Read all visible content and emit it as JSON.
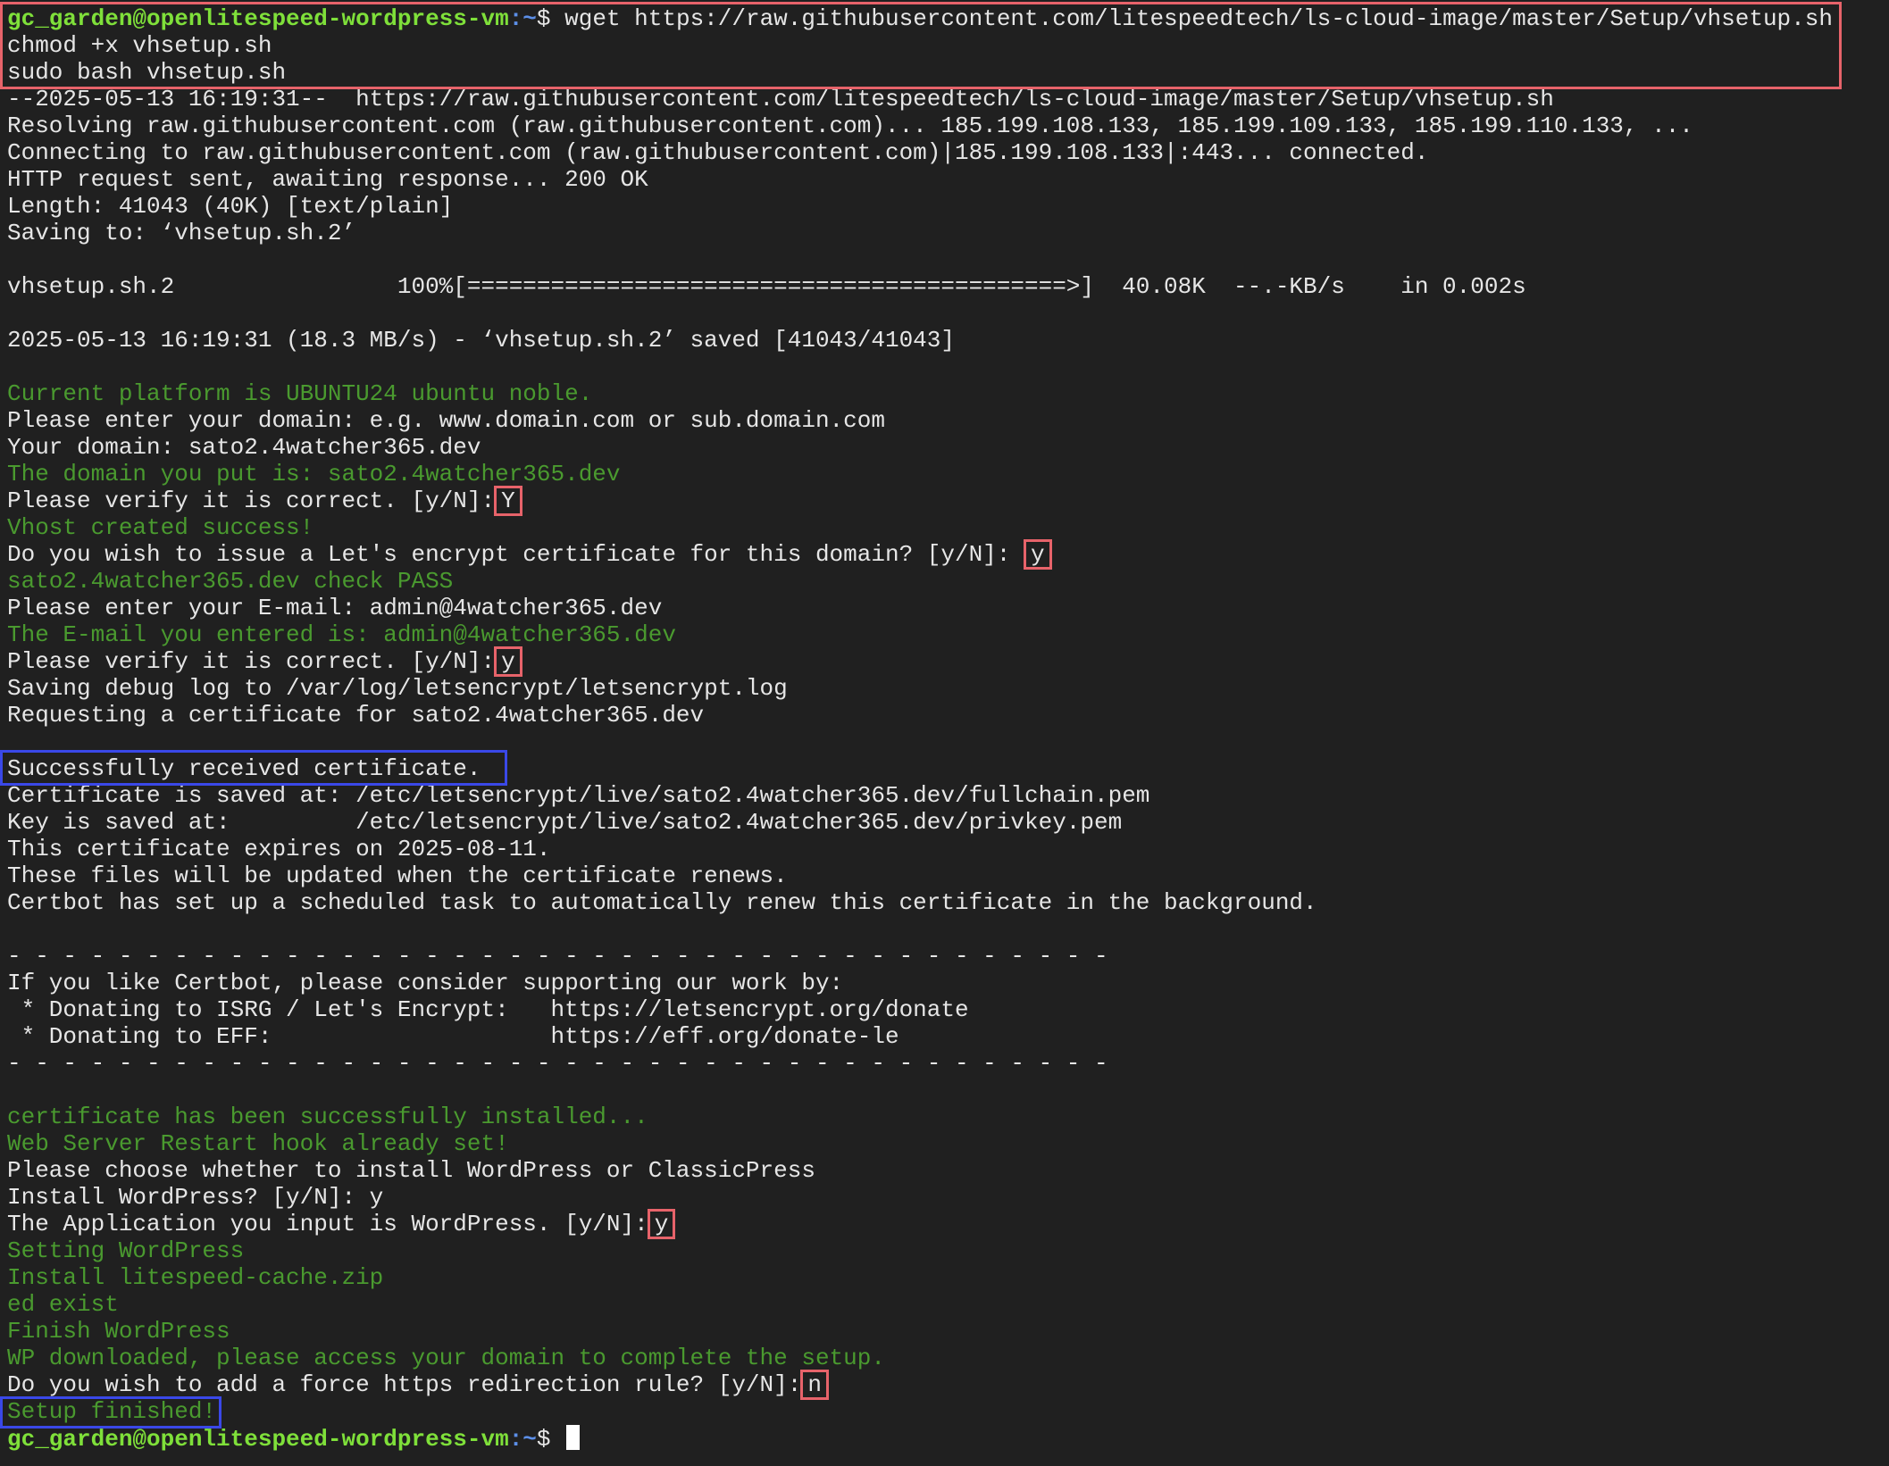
{
  "colors": {
    "background": "#202020",
    "text": "#e6e6e6",
    "info_green": "#4a9a2f",
    "prompt_green": "#7fe03a",
    "prompt_blue": "#5c8fe8",
    "highlight_red": "#e7636a",
    "highlight_blue": "#3a48e8"
  },
  "prompt": {
    "user_host": "gc_garden@openlitespeed-wordpress-vm",
    "path": ":~",
    "symbol": "$ "
  },
  "commands": {
    "wget": "wget https://raw.githubusercontent.com/litespeedtech/ls-cloud-image/master/Setup/vhsetup.sh",
    "chmod": "chmod +x vhsetup.sh",
    "sudo": "sudo bash vhsetup.sh"
  },
  "wget_output": {
    "start": "--2025-05-13 16:19:31--  https://raw.githubusercontent.com/litespeedtech/ls-cloud-image/master/Setup/vhsetup.sh",
    "resolving": "Resolving raw.githubusercontent.com (raw.githubusercontent.com)... 185.199.108.133, 185.199.109.133, 185.199.110.133, ...",
    "connecting": "Connecting to raw.githubusercontent.com (raw.githubusercontent.com)|185.199.108.133|:443... connected.",
    "http": "HTTP request sent, awaiting response... 200 OK",
    "length": "Length: 41043 (40K) [text/plain]",
    "saving": "Saving to: ‘vhsetup.sh.2’",
    "progress": "vhsetup.sh.2                100%[===========================================>]  40.08K  --.-KB/s    in 0.002s",
    "saved": "2025-05-13 16:19:31 (18.3 MB/s) - ‘vhsetup.sh.2’ saved [41043/41043]"
  },
  "setup": {
    "platform": "Current platform is UBUNTU24 ubuntu noble.",
    "enter_domain": "Please enter your domain: e.g. www.domain.com or sub.domain.com",
    "your_domain": "Your domain: sato2.4watcher365.dev",
    "domain_put": "The domain you put is: sato2.4watcher365.dev",
    "verify1_q": "Please verify it is correct. [y/N]:",
    "verify1_a": "Y",
    "vhost_created": "Vhost created success!",
    "le_q": "Do you wish to issue a Let's encrypt certificate for this domain? [y/N]:",
    "le_a": "y",
    "check_pass": "sato2.4watcher365.dev check PASS",
    "enter_email": "Please enter your E-mail: admin@4watcher365.dev",
    "email_entered": "The E-mail you entered is: admin@4watcher365.dev",
    "verify2_q": "Please verify it is correct. [y/N]:",
    "verify2_a": "y",
    "debug_log": "Saving debug log to /var/log/letsencrypt/letsencrypt.log",
    "requesting": "Requesting a certificate for sato2.4watcher365.dev"
  },
  "certbot": {
    "success": "Successfully received certificate.",
    "cert_saved": "Certificate is saved at: /etc/letsencrypt/live/sato2.4watcher365.dev/fullchain.pem",
    "key_saved": "Key is saved at:         /etc/letsencrypt/live/sato2.4watcher365.dev/privkey.pem",
    "expires": "This certificate expires on 2025-08-11.",
    "updated": "These files will be updated when the certificate renews.",
    "scheduled": "Certbot has set up a scheduled task to automatically renew this certificate in the background.",
    "separator": "- - - - - - - - - - - - - - - - - - - - - - - - - - - - - - - - - - - - - - - -",
    "support": "If you like Certbot, please consider supporting our work by:",
    "donate_isrg": " * Donating to ISRG / Let's Encrypt:   https://letsencrypt.org/donate",
    "donate_eff": " * Donating to EFF:                    https://eff.org/donate-le"
  },
  "wordpress": {
    "installed": "certificate has been successfully installed...",
    "restart_hook": "Web Server Restart hook already set!",
    "choose": "Please choose whether to install WordPress or ClassicPress",
    "install_wp": "Install WordPress? [y/N]: y",
    "app_q": "The Application you input is WordPress. [y/N]:",
    "app_a": "y",
    "setting": "Setting WordPress",
    "install_cache": "Install litespeed-cache.zip",
    "ed_exist": "ed exist",
    "finish": "Finish WordPress",
    "downloaded": "WP downloaded, please access your domain to complete the setup.",
    "https_q": "Do you wish to add a force https redirection rule? [y/N]:",
    "https_a": "n",
    "setup_finished": "Setup finished!"
  }
}
